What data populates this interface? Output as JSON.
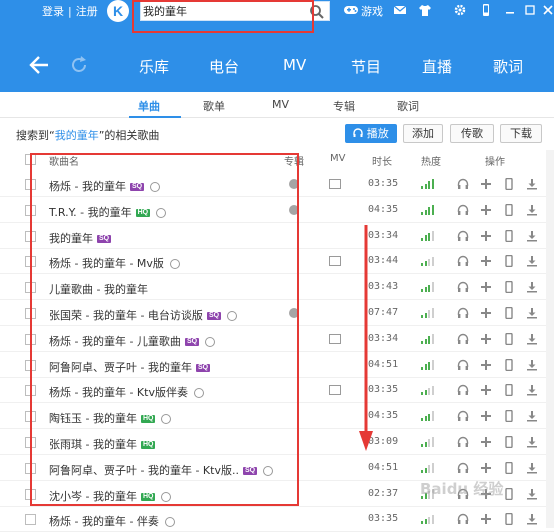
{
  "top": {
    "login": "登录",
    "separator": "|",
    "register": "注册",
    "logo": "K",
    "game": "游戏"
  },
  "search": {
    "value": "我的童年",
    "placeholder": ""
  },
  "nav": {
    "items": [
      "乐库",
      "电台",
      "MV",
      "节目",
      "直播",
      "歌词"
    ]
  },
  "tabs": [
    "单曲",
    "歌单",
    "MV",
    "专辑",
    "歌词"
  ],
  "result": {
    "prefix": "搜索到“",
    "keyword": "我的童年",
    "suffix": "”的相关歌曲"
  },
  "buttons": {
    "play": "播放",
    "add": "添加",
    "upload": "传歌",
    "download": "下载"
  },
  "columns": {
    "name": "歌曲名",
    "album": "专辑",
    "mv": "MV",
    "duration": "时长",
    "popularity": "热度",
    "actions": "操作"
  },
  "songs": [
    {
      "title": "杨烁 - 我的童年",
      "badge": "SQ",
      "duration": "03:35"
    },
    {
      "title": "T.R.Y. - 我的童年",
      "badge": "HQ",
      "duration": "04:35"
    },
    {
      "title": "我的童年",
      "badge": "SQ",
      "duration": "03:34"
    },
    {
      "title": "杨烁 - 我的童年 - Mv版",
      "badge": "",
      "duration": "03:44"
    },
    {
      "title": "儿童歌曲 - 我的童年",
      "badge": "",
      "duration": "03:43"
    },
    {
      "title": "张国荣 - 我的童年 - 电台访谈版",
      "badge": "SQ",
      "duration": "07:47"
    },
    {
      "title": "杨烁 - 我的童年 - 儿童歌曲",
      "badge": "SQ",
      "duration": "03:34"
    },
    {
      "title": "阿鲁阿卓、贾子叶 - 我的童年",
      "badge": "SQ",
      "duration": "04:51"
    },
    {
      "title": "杨烁 - 我的童年 - Ktv版伴奏",
      "badge": "",
      "duration": "03:35"
    },
    {
      "title": "陶钰玉 - 我的童年",
      "badge": "HQ",
      "duration": "04:35"
    },
    {
      "title": "张雨琪 - 我的童年",
      "badge": "HQ",
      "duration": "03:09"
    },
    {
      "title": "阿鲁阿卓、贾子叶 - 我的童年 - Ktv版..",
      "badge": "SQ",
      "duration": "04:51"
    },
    {
      "title": "沈小岑 - 我的童年",
      "badge": "HQ",
      "duration": "02:37"
    },
    {
      "title": "杨烁 - 我的童年 - 伴奏",
      "badge": "",
      "duration": "03:35"
    }
  ],
  "watermark": "Baidu 经验",
  "colors": {
    "accent": "#2e8fe8",
    "highlight": "#e53935",
    "hq": "#32a852",
    "sq": "#8e44ad"
  }
}
